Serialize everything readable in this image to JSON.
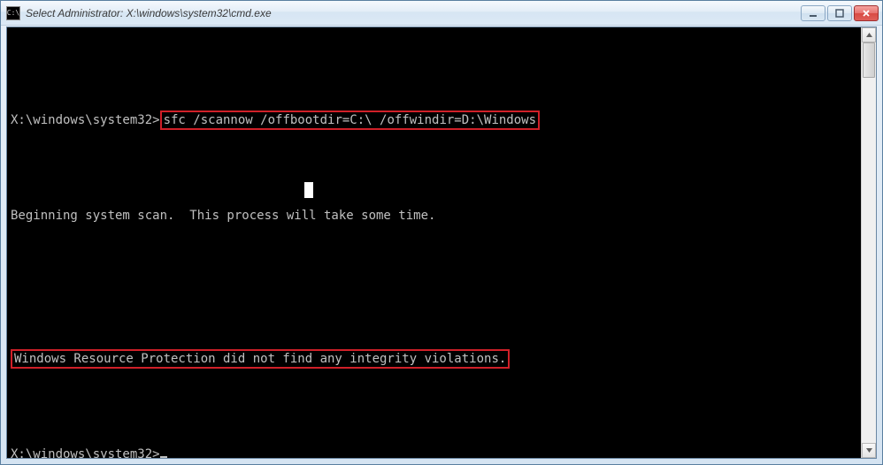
{
  "window": {
    "title": "Select Administrator: X:\\windows\\system32\\cmd.exe",
    "app_icon_label": "C:\\"
  },
  "controls": {
    "minimize": "minimize",
    "maximize": "maximize",
    "close": "close"
  },
  "terminal": {
    "prompt1": "X:\\windows\\system32>",
    "command1": "sfc /scannow /offbootdir=C:\\ /offwindir=D:\\Windows",
    "line2": "Beginning system scan.  This process will take some time.",
    "line3": "Windows Resource Protection did not find any integrity violations.",
    "prompt2": "X:\\windows\\system32>"
  }
}
